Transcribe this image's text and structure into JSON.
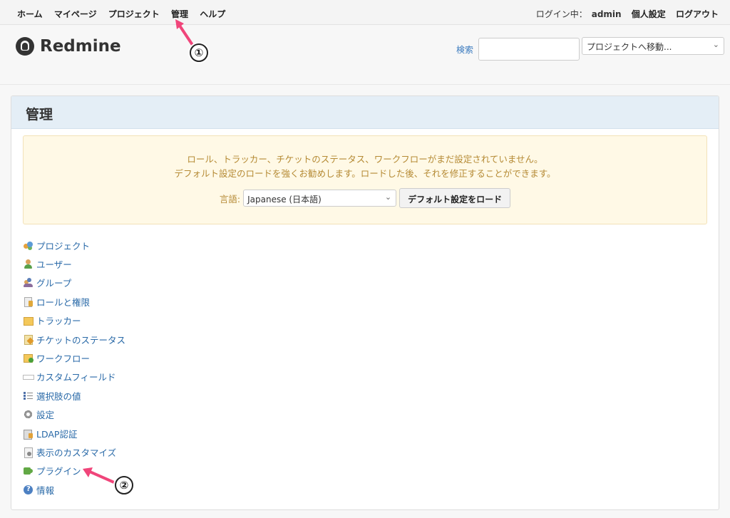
{
  "top_menu": {
    "home": "ホーム",
    "my_page": "マイページ",
    "projects": "プロジェクト",
    "administration": "管理",
    "help": "ヘルプ",
    "logged_in_label": "ログイン中：",
    "username": "admin",
    "my_account": "個人設定",
    "sign_out": "ログアウト"
  },
  "header": {
    "app_name": "Redmine",
    "search_label": "検索",
    "search_value": "",
    "project_jump": "プロジェクトへ移動..."
  },
  "main": {
    "title": "管理",
    "notice": {
      "line1": "ロール、トラッカー、チケットのステータス、ワークフローがまだ設定されていません。",
      "line2": "デフォルト設定のロードを強くお勧めします。ロードした後、それを修正することができます。",
      "language_label": "言語:",
      "language_value": "Japanese (日本語)",
      "load_button": "デフォルト設定をロード"
    },
    "menu": [
      {
        "label": "プロジェクト",
        "icon": "projects-icon"
      },
      {
        "label": "ユーザー",
        "icon": "user-icon"
      },
      {
        "label": "グループ",
        "icon": "group-icon"
      },
      {
        "label": "ロールと権限",
        "icon": "role-icon"
      },
      {
        "label": "トラッカー",
        "icon": "tracker-icon"
      },
      {
        "label": "チケットのステータス",
        "icon": "issue-status-icon"
      },
      {
        "label": "ワークフロー",
        "icon": "workflow-icon"
      },
      {
        "label": "カスタムフィールド",
        "icon": "custom-field-icon"
      },
      {
        "label": "選択肢の値",
        "icon": "enumeration-icon"
      },
      {
        "label": "設定",
        "icon": "settings-icon"
      },
      {
        "label": "LDAP認証",
        "icon": "ldap-icon"
      },
      {
        "label": "表示のカスタマイズ",
        "icon": "view-customize-icon"
      },
      {
        "label": "プラグイン",
        "icon": "plugin-icon"
      },
      {
        "label": "情報",
        "icon": "info-icon"
      }
    ]
  },
  "annotations": {
    "callout1": "①",
    "callout2": "②",
    "arrow_color": "#f0457a"
  }
}
